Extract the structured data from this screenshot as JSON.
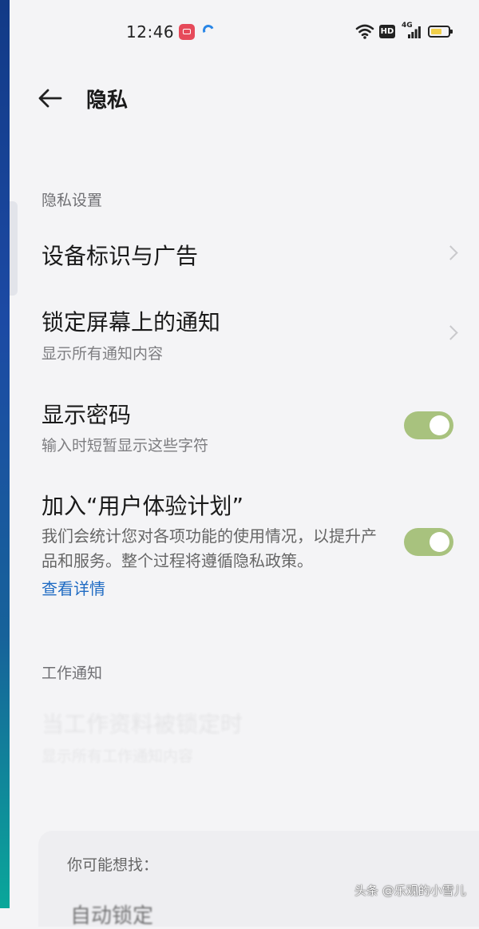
{
  "status_bar": {
    "time": "12:46",
    "network_label": "4G",
    "hd_label": "HD",
    "icons": [
      "video-notification-icon",
      "loading-notification-icon",
      "wifi-icon",
      "hd-icon",
      "signal-icon",
      "battery-icon"
    ],
    "battery_color": "#f2d04a"
  },
  "header": {
    "title": "隐私",
    "back_icon": "back-arrow-icon"
  },
  "privacy_section": {
    "header": "隐私设置",
    "items": [
      {
        "title": "设备标识与广告",
        "control": "chevron"
      },
      {
        "title": "锁定屏幕上的通知",
        "subtitle": "显示所有通知内容",
        "control": "chevron"
      },
      {
        "title": "显示密码",
        "subtitle": "输入时短暂显示这些字符",
        "control": "toggle",
        "enabled": true
      },
      {
        "title": "加入“用户体验计划”",
        "description": "我们会统计您对各项功能的使用情况，以提升产品和服务。整个过程将遵循隐私政策。",
        "link": "查看详情",
        "control": "toggle",
        "enabled": true
      }
    ]
  },
  "work_section": {
    "header": "工作通知"
  },
  "suggestions": {
    "label": "你可能想找："
  },
  "colors": {
    "toggle_on": "#a8c27e",
    "link": "#1f6bc3",
    "background": "#f4f4f6"
  },
  "watermark": "头条 @乐观的小雪儿"
}
